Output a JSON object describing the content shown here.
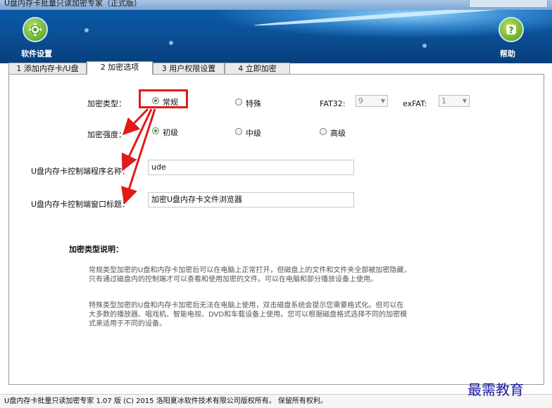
{
  "window": {
    "title": "U盘内存卡批量只读加密专家（正式版）"
  },
  "header": {
    "settings_label": "软件设置",
    "help_label": "帮助",
    "gear_icon": "gear-icon",
    "help_icon": "question-icon"
  },
  "tabs": [
    {
      "label": "1 添加内存卡/U盘"
    },
    {
      "label": "2 加密选项"
    },
    {
      "label": "3 用户权限设置"
    },
    {
      "label": "4 立即加密"
    }
  ],
  "active_tab": 1,
  "form": {
    "encrypt_type_label": "加密类型：",
    "type_normal": "常规",
    "type_special": "特殊",
    "fat32_label": "FAT32:",
    "fat32_value": "9",
    "exfat_label": "exFAT:",
    "exfat_value": "1",
    "strength_label": "加密强度：",
    "strength_basic": "初级",
    "strength_medium": "中级",
    "strength_high": "高级",
    "program_name_label": "U盘内存卡控制端程序名称：",
    "program_name_value": "ude",
    "window_title_label": "U盘内存卡控制端窗口标题：",
    "window_title_value": "加密U盘内存卡文件浏览器"
  },
  "description": {
    "title": "加密类型说明：",
    "p1_line1": "常规类型加密的U盘和内存卡加密后可以在电脑上正常打开，但磁盘上的文件和文件夹全部被加密隐藏，",
    "p1_line2": "只有通过磁盘内的控制端才可以查看和使用加密的文件。可以在电脑和部分播放设备上使用。",
    "p2_line1": "特殊类型加密的U盘和内存卡加密后无法在电脑上使用，双击磁盘系统会提示您需要格式化。但可以在",
    "p2_line2": "大多数的播放器、唱戏机、智能电视、DVD和车载设备上使用。您可以根据磁盘格式选择不同的加密模",
    "p2_line3": "式来适用于不同的设备。"
  },
  "footer": {
    "text": "U盘内存卡批量只读加密专家 1.07 版  (C) 2015 洛阳夏冰软件技术有限公司版权所有。 保留所有权利。"
  },
  "watermark": "最需教育",
  "colors": {
    "header_blue": "#0a4f95",
    "highlight_red": "#e21a1a",
    "radio_green": "#2a9a2a"
  }
}
